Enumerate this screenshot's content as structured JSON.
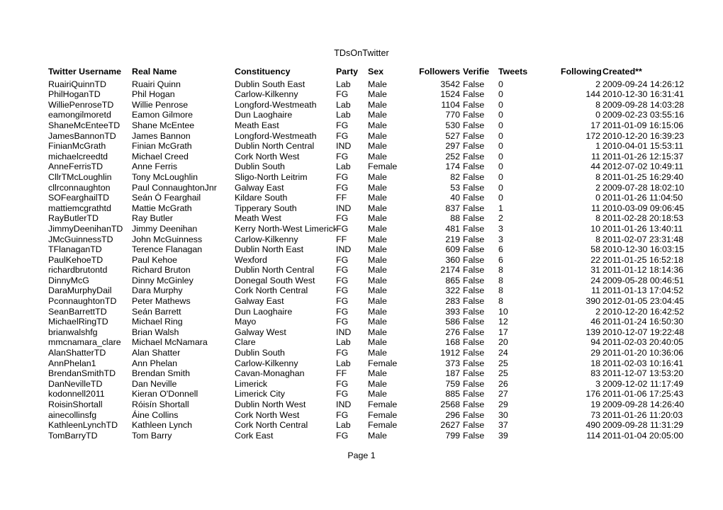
{
  "document": {
    "title": "TDsOnTwitter",
    "footer": "Page 1"
  },
  "table": {
    "headers": {
      "username": "Twitter Username",
      "real_name": "Real Name",
      "constituency": "Constituency",
      "party": "Party",
      "sex": "Sex",
      "followers": "Followers",
      "verified": "Verifie",
      "tweets": "Tweets",
      "following": "Following",
      "created": "Created**"
    },
    "rows": [
      {
        "username": "RuairiQuinnTD",
        "real_name": "Ruairi Quinn",
        "constituency": "Dublin South East",
        "party": "Lab",
        "sex": "Male",
        "followers": "3542",
        "verified": "False",
        "tweets": "0",
        "following": "2",
        "created": "2009-09-24 14:26:12"
      },
      {
        "username": "PhilHoganTD",
        "real_name": "Phil Hogan",
        "constituency": "Carlow-Kilkenny",
        "party": "FG",
        "sex": "Male",
        "followers": "1524",
        "verified": "False",
        "tweets": "0",
        "following": "144",
        "created": "2010-12-30 16:31:41"
      },
      {
        "username": "WilliePenroseTD",
        "real_name": "Willie Penrose",
        "constituency": "Longford-Westmeath",
        "party": "Lab",
        "sex": "Male",
        "followers": "1104",
        "verified": "False",
        "tweets": "0",
        "following": "8",
        "created": "2009-09-28 14:03:28"
      },
      {
        "username": "eamongilmoretd",
        "real_name": "Eamon Gilmore",
        "constituency": "Dun Laoghaire",
        "party": "Lab",
        "sex": "Male",
        "followers": "770",
        "verified": "False",
        "tweets": "0",
        "following": "0",
        "created": "2009-02-23 03:55:16"
      },
      {
        "username": "ShaneMcEnteeTD",
        "real_name": "Shane McEntee",
        "constituency": "Meath East",
        "party": "FG",
        "sex": "Male",
        "followers": "530",
        "verified": "False",
        "tweets": "0",
        "following": "17",
        "created": "2011-01-09 16:15:06"
      },
      {
        "username": "JamesBannonTD",
        "real_name": "James Bannon",
        "constituency": "Longford-Westmeath",
        "party": "FG",
        "sex": "Male",
        "followers": "527",
        "verified": "False",
        "tweets": "0",
        "following": "172",
        "created": "2010-12-20 16:39:23"
      },
      {
        "username": "FinianMcGrath",
        "real_name": "Finian McGrath",
        "constituency": "Dublin North Central",
        "party": "IND",
        "sex": "Male",
        "followers": "297",
        "verified": "False",
        "tweets": "0",
        "following": "1",
        "created": "2010-04-01 15:53:11"
      },
      {
        "username": "michaelcreedtd",
        "real_name": "Michael Creed",
        "constituency": "Cork North West",
        "party": "FG",
        "sex": "Male",
        "followers": "252",
        "verified": "False",
        "tweets": "0",
        "following": "11",
        "created": "2011-01-26 12:15:37"
      },
      {
        "username": "AnneFerrisTD",
        "real_name": "Anne Ferris",
        "constituency": "Dublin South",
        "party": "Lab",
        "sex": "Female",
        "followers": "174",
        "verified": "False",
        "tweets": "0",
        "following": "44",
        "created": "2012-07-02 10:49:11"
      },
      {
        "username": "CllrTMcLoughlin",
        "real_name": "Tony McLoughlin",
        "constituency": "Sligo-North Leitrim",
        "party": "FG",
        "sex": "Male",
        "followers": "82",
        "verified": "False",
        "tweets": "0",
        "following": "8",
        "created": "2011-01-25 16:29:40"
      },
      {
        "username": "cllrconnaughton",
        "real_name": "Paul ConnaughtonJnr",
        "constituency": "Galway East",
        "party": "FG",
        "sex": "Male",
        "followers": "53",
        "verified": "False",
        "tweets": "0",
        "following": "2",
        "created": "2009-07-28 18:02:10"
      },
      {
        "username": "SOFearghailTD",
        "real_name": "Seán Ó Fearghail",
        "constituency": "Kildare South",
        "party": "FF",
        "sex": "Male",
        "followers": "40",
        "verified": "False",
        "tweets": "0",
        "following": "0",
        "created": "2011-01-26 11:04:50"
      },
      {
        "username": "mattiemcgrathtd",
        "real_name": "Mattie McGrath",
        "constituency": "Tipperary South",
        "party": "IND",
        "sex": "Male",
        "followers": "837",
        "verified": "False",
        "tweets": "1",
        "following": "11",
        "created": "2010-03-09 09:06:45"
      },
      {
        "username": "RayButlerTD",
        "real_name": "Ray Butler",
        "constituency": "Meath West",
        "party": "FG",
        "sex": "Male",
        "followers": "88",
        "verified": "False",
        "tweets": "2",
        "following": "8",
        "created": "2011-02-28 20:18:53"
      },
      {
        "username": "JimmyDeenihanTD",
        "real_name": "Jimmy Deenihan",
        "constituency": "Kerry North-West Limerick",
        "party": "FG",
        "sex": "Male",
        "followers": "481",
        "verified": "False",
        "tweets": "3",
        "following": "10",
        "created": "2011-01-26 13:40:11"
      },
      {
        "username": "JMcGuinnessTD",
        "real_name": "John McGuinness",
        "constituency": "Carlow-Kilkenny",
        "party": "FF",
        "sex": "Male",
        "followers": "219",
        "verified": "False",
        "tweets": "3",
        "following": "8",
        "created": "2011-02-07 23:31:48"
      },
      {
        "username": "TFlanaganTD",
        "real_name": "Terence Flanagan",
        "constituency": "Dublin North East",
        "party": "IND",
        "sex": "Male",
        "followers": "609",
        "verified": "False",
        "tweets": "6",
        "following": "58",
        "created": "2010-12-30 16:03:15"
      },
      {
        "username": "PaulKehoeTD",
        "real_name": "Paul Kehoe",
        "constituency": "Wexford",
        "party": "FG",
        "sex": "Male",
        "followers": "360",
        "verified": "False",
        "tweets": "6",
        "following": "22",
        "created": "2011-01-25 16:52:18"
      },
      {
        "username": "richardbrutontd",
        "real_name": "Richard Bruton",
        "constituency": "Dublin North Central",
        "party": "FG",
        "sex": "Male",
        "followers": "2174",
        "verified": "False",
        "tweets": "8",
        "following": "31",
        "created": "2011-01-12 18:14:36"
      },
      {
        "username": "DinnyMcG",
        "real_name": "Dinny McGinley",
        "constituency": "Donegal South West",
        "party": "FG",
        "sex": "Male",
        "followers": "865",
        "verified": "False",
        "tweets": "8",
        "following": "24",
        "created": "2009-05-28 00:46:51"
      },
      {
        "username": "DaraMurphyDail",
        "real_name": "Dara Murphy",
        "constituency": "Cork North Central",
        "party": "FG",
        "sex": "Male",
        "followers": "322",
        "verified": "False",
        "tweets": "8",
        "following": "11",
        "created": "2011-01-13 17:04:52"
      },
      {
        "username": "PconnaughtonTD",
        "real_name": "Peter Mathews",
        "constituency": "Galway East",
        "party": "FG",
        "sex": "Male",
        "followers": "283",
        "verified": "False",
        "tweets": "8",
        "following": "390",
        "created": "2012-01-05 23:04:45"
      },
      {
        "username": "SeanBarrettTD",
        "real_name": "Seán Barrett",
        "constituency": "Dun Laoghaire",
        "party": "FG",
        "sex": "Male",
        "followers": "393",
        "verified": "False",
        "tweets": "10",
        "following": "2",
        "created": "2010-12-20 16:42:52"
      },
      {
        "username": "MichaelRingTD",
        "real_name": "Michael Ring",
        "constituency": "Mayo",
        "party": "FG",
        "sex": "Male",
        "followers": "586",
        "verified": "False",
        "tweets": "12",
        "following": "46",
        "created": "2011-01-24 16:50:30"
      },
      {
        "username": "brianwalshfg",
        "real_name": "Brian Walsh",
        "constituency": "Galway West",
        "party": "IND",
        "sex": "Male",
        "followers": "276",
        "verified": "False",
        "tweets": "17",
        "following": "139",
        "created": "2010-12-07 19:22:48"
      },
      {
        "username": "mmcnamara_clare",
        "real_name": "Michael McNamara",
        "constituency": "Clare",
        "party": "Lab",
        "sex": "Male",
        "followers": "168",
        "verified": "False",
        "tweets": "20",
        "following": "94",
        "created": "2011-02-03 20:40:05"
      },
      {
        "username": "AlanShatterTD",
        "real_name": "Alan Shatter",
        "constituency": "Dublin South",
        "party": "FG",
        "sex": "Male",
        "followers": "1912",
        "verified": "False",
        "tweets": "24",
        "following": "29",
        "created": "2011-01-20 10:36:06"
      },
      {
        "username": "AnnPhelan1",
        "real_name": "Ann Phelan",
        "constituency": "Carlow-Kilkenny",
        "party": "Lab",
        "sex": "Female",
        "followers": "373",
        "verified": "False",
        "tweets": "25",
        "following": "18",
        "created": "2011-02-03 10:16:41"
      },
      {
        "username": "BrendanSmithTD",
        "real_name": "Brendan Smith",
        "constituency": "Cavan-Monaghan",
        "party": "FF",
        "sex": "Male",
        "followers": "187",
        "verified": "False",
        "tweets": "25",
        "following": "83",
        "created": "2011-12-07 13:53:20"
      },
      {
        "username": "DanNevilleTD",
        "real_name": "Dan Neville",
        "constituency": "Limerick",
        "party": "FG",
        "sex": "Male",
        "followers": "759",
        "verified": "False",
        "tweets": "26",
        "following": "3",
        "created": "2009-12-02 11:17:49"
      },
      {
        "username": "kodonnell2011",
        "real_name": "Kieran O'Donnell",
        "constituency": "Limerick City",
        "party": "FG",
        "sex": "Male",
        "followers": "885",
        "verified": "False",
        "tweets": "27",
        "following": "176",
        "created": "2011-01-06 17:25:43"
      },
      {
        "username": "RoisinShortall",
        "real_name": "Róisín Shortall",
        "constituency": "Dublin North West",
        "party": "IND",
        "sex": "Female",
        "followers": "2568",
        "verified": "False",
        "tweets": "29",
        "following": "19",
        "created": "2009-09-28 14:26:40"
      },
      {
        "username": "ainecollinsfg",
        "real_name": "Áine Collins",
        "constituency": "Cork North West",
        "party": "FG",
        "sex": "Female",
        "followers": "296",
        "verified": "False",
        "tweets": "30",
        "following": "73",
        "created": "2011-01-26 11:20:03"
      },
      {
        "username": "KathleenLynchTD",
        "real_name": "Kathleen Lynch",
        "constituency": "Cork North Central",
        "party": "Lab",
        "sex": "Female",
        "followers": "2627",
        "verified": "False",
        "tweets": "37",
        "following": "490",
        "created": "2009-09-28 11:31:29"
      },
      {
        "username": "TomBarryTD",
        "real_name": "Tom Barry",
        "constituency": "Cork East",
        "party": "FG",
        "sex": "Male",
        "followers": "799",
        "verified": "False",
        "tweets": "39",
        "following": "114",
        "created": "2011-01-04 20:05:00"
      }
    ]
  }
}
